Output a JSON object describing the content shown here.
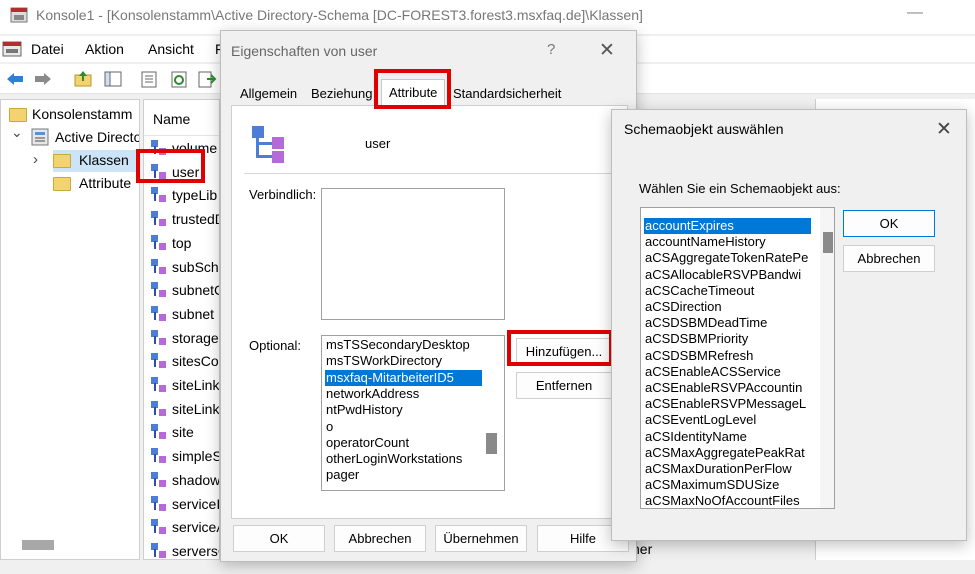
{
  "window": {
    "title": "Konsole1 - [Konsolenstamm\\Active Directory-Schema [DC-FOREST3.forest3.msxfaq.de]\\Klassen]",
    "minimize_glyph": "—"
  },
  "menu": [
    "Datei",
    "Aktion",
    "Ansicht",
    "F"
  ],
  "tree": {
    "items": [
      {
        "label": "Konsolenstamm",
        "icon": "folder-icon"
      },
      {
        "label": "Active Directo",
        "icon": "schema-icon",
        "expander": "⌄"
      },
      {
        "label": "Klassen",
        "icon": "folder-icon",
        "expander": "›"
      },
      {
        "label": "Attribute",
        "icon": "folder-icon"
      }
    ]
  },
  "list": {
    "header": "Name",
    "items": [
      "volume",
      "user",
      "typeLib",
      "trustedD",
      "top",
      "subSche",
      "subnetC",
      "subnet",
      "storage",
      "sitesCon",
      "siteLink",
      "siteLink",
      "site",
      "simpleS",
      "shadow",
      "serviceI",
      "serviceA",
      "serversC"
    ]
  },
  "background_text": "ner",
  "prop_dialog": {
    "title": "Eigenschaften von user",
    "help": "?",
    "close": "✕",
    "tabs": [
      "Allgemein",
      "Beziehung",
      "Attribute",
      "Standardsicherheit"
    ],
    "active_tab": "Attribute",
    "object_name": "user",
    "mandatory_label": "Verbindlich:",
    "optional_label": "Optional:",
    "optional_items": [
      "msTSSecondaryDesktop",
      "msTSWorkDirectory",
      "msxfaq-MitarbeiterID5",
      "networkAddress",
      "ntPwdHistory",
      "o",
      "operatorCount",
      "otherLoginWorkstations",
      "pager"
    ],
    "selected_optional": "msxfaq-MitarbeiterID5",
    "add_button": "Hinzufügen...",
    "remove_button": "Entfernen",
    "buttons": {
      "ok": "OK",
      "cancel": "Abbrechen",
      "apply": "Übernehmen",
      "help": "Hilfe"
    }
  },
  "pick_dialog": {
    "title": "Schemaobjekt auswählen",
    "close": "✕",
    "label": "Wählen Sie ein Schemaobjekt aus:",
    "items": [
      "accountExpires",
      "accountNameHistory",
      "aCSAggregateTokenRatePe",
      "aCSAllocableRSVPBandwi",
      "aCSCacheTimeout",
      "aCSDirection",
      "aCSDSBMDeadTime",
      "aCSDSBMPriority",
      "aCSDSBMRefresh",
      "aCSEnableACSService",
      "aCSEnableRSVPAccountin",
      "aCSEnableRSVPMessageL",
      "aCSEventLogLevel",
      "aCSIdentityName",
      "aCSMaxAggregatePeakRat",
      "aCSMaxDurationPerFlow",
      "aCSMaximumSDUSize",
      "aCSMaxNoOfAccountFiles"
    ],
    "selected": "accountExpires",
    "ok": "OK",
    "cancel": "Abbrechen"
  },
  "colors": {
    "highlight_box": "#e00000",
    "selection": "#0078d7"
  }
}
